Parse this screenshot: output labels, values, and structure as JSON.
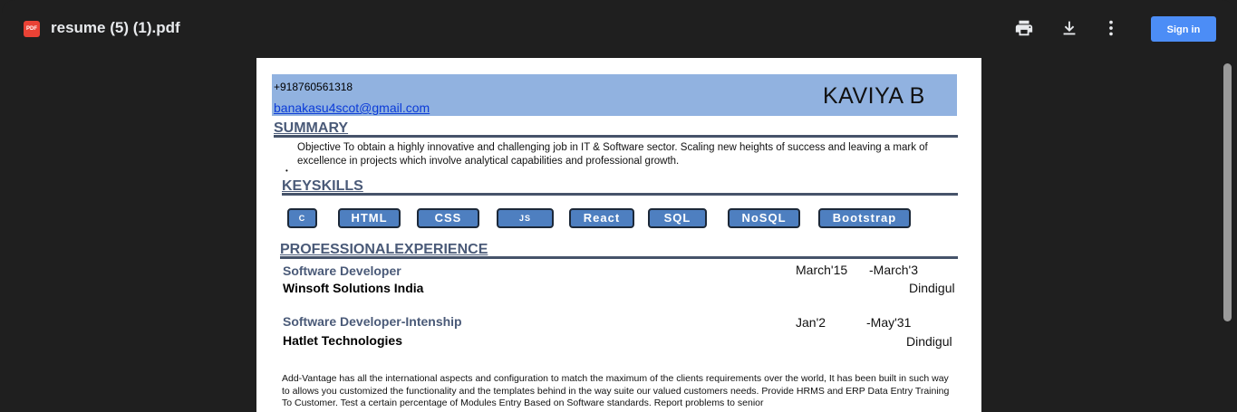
{
  "viewer": {
    "file_icon_label": "PDF",
    "title": "resume (5) (1).pdf",
    "sign_in_label": "Sign in"
  },
  "resume": {
    "phone": "+918760561318",
    "email": "banakasu4scot@gmail.com",
    "name": "KAVIYA B",
    "summary_heading": "SUMMARY",
    "summary_text": "Objective To obtain a highly innovative and challenging job in IT & Software sector. Scaling new heights of success and leaving a mark of excellence in projects which involve analytical capabilities and professional growth.",
    "keyskills_heading": "KEYSKILLS",
    "skills": [
      "C",
      "HTML",
      "CSS",
      "JS",
      "React",
      "SQL",
      "NoSQL",
      "Bootstrap"
    ],
    "experience_heading": "PROFESSIONALEXPERIENCE",
    "jobs": [
      {
        "title": "Software Developer",
        "start": "March'15",
        "end": "-March'3",
        "company": "Winsoft Solutions India",
        "location": "Dindigul"
      },
      {
        "title": "Software Developer-Intenship",
        "start": "Jan'2",
        "end": "-May'31",
        "company": "Hatlet Technologies",
        "location": "Dindigul"
      }
    ],
    "description": "Add-Vantage has all the international aspects and configuration to match the maximum of the clients requirements over the world, It has been built in such way to allows you customized the functionality and the templates behind in the way suite our valued customers needs. Provide HRMS and ERP Data Entry Training To Customer. Test a certain percentage of Modules Entry Based on Software standards. Report problems to senior"
  }
}
